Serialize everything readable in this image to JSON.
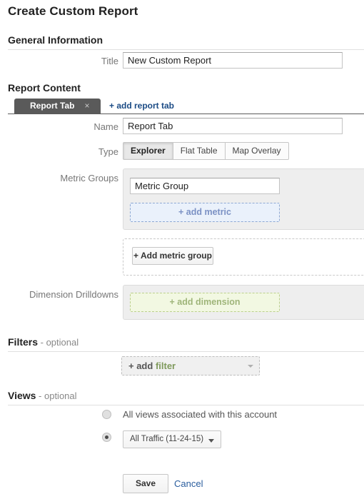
{
  "page": {
    "title": "Create Custom Report"
  },
  "general": {
    "heading": "General Information",
    "title_label": "Title",
    "title_value": "New Custom Report",
    "title_placeholder": "New Custom Report"
  },
  "report_content": {
    "heading": "Report Content",
    "tab": {
      "label": "Report Tab",
      "close_icon": "×"
    },
    "add_tab_label": "+ add report tab",
    "name_label": "Name",
    "name_value": "Report Tab",
    "name_placeholder": "Report Tab",
    "type_label": "Type",
    "type_options": [
      {
        "label": "Explorer",
        "selected": true
      },
      {
        "label": "Flat Table",
        "selected": false
      },
      {
        "label": "Map Overlay",
        "selected": false
      }
    ],
    "metric_groups_label": "Metric Groups",
    "metric_group_value": "Metric Group",
    "metric_group_placeholder": "Metric Group",
    "add_metric_label": "+ add metric",
    "add_metric_group_label": "+ Add metric group",
    "dimension_label": "Dimension Drilldowns",
    "add_dimension_label": "+ add dimension"
  },
  "filters": {
    "heading": "Filters",
    "optional_suffix": " - optional",
    "add_filter_plus": "+ add ",
    "add_filter_word": "filter"
  },
  "views": {
    "heading": "Views",
    "optional_suffix": " - optional",
    "all_views_label": "All views associated with this account",
    "all_views_selected": false,
    "specific_view_selected": true,
    "specific_view_value": "All Traffic (11-24-15)"
  },
  "actions": {
    "save_label": "Save",
    "cancel_label": "Cancel"
  },
  "colors": {
    "tab_bg": "#5a5a5a",
    "link": "#1b4b85",
    "metric_accent": "#7b91c4",
    "dimension_accent": "#9fb57a",
    "filter_accent": "#7f9a5c"
  }
}
